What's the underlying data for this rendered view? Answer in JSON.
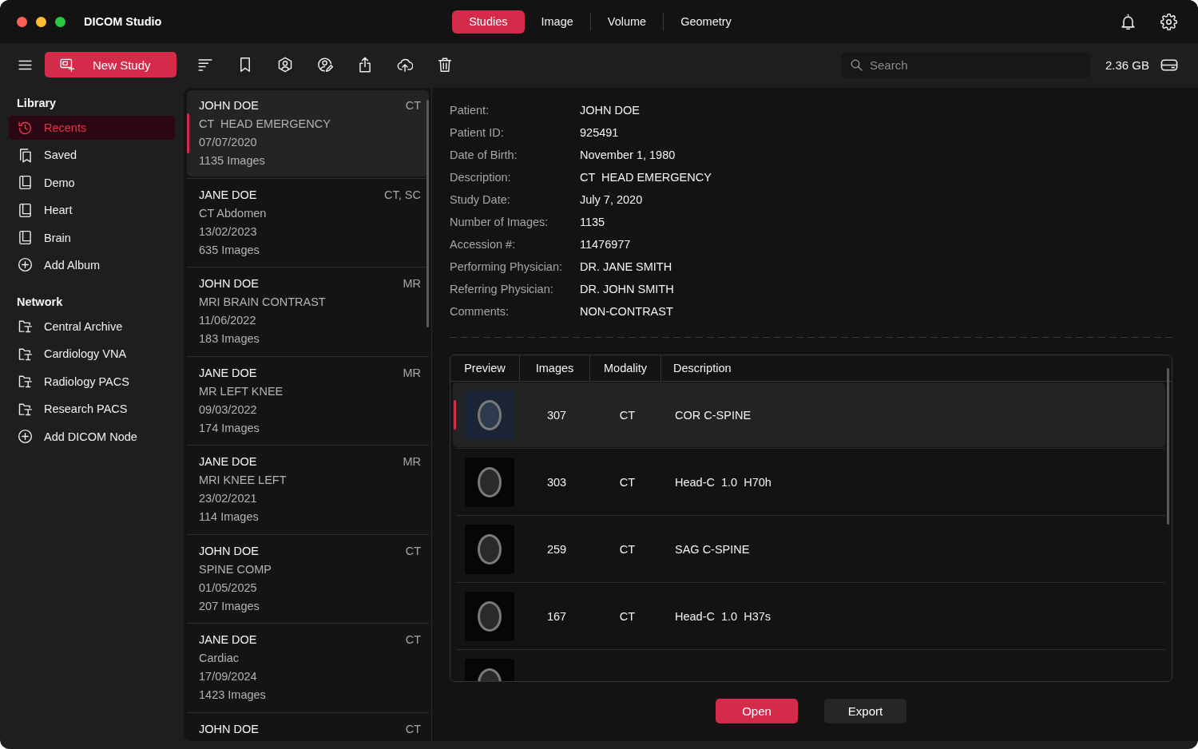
{
  "window": {
    "title": "DICOM Studio"
  },
  "tabs": [
    {
      "label": "Studies",
      "selected": true
    },
    {
      "label": "Image",
      "selected": false
    },
    {
      "label": "Volume",
      "selected": false
    },
    {
      "label": "Geometry",
      "selected": false
    }
  ],
  "toolbar": {
    "new_study": "New Study",
    "search": {
      "placeholder": "Search"
    },
    "storage": "2.36 GB"
  },
  "sidebar": {
    "sections": [
      {
        "heading": "Library",
        "items": [
          {
            "label": "Recents",
            "kind": "history",
            "selected": true
          },
          {
            "label": "Saved",
            "kind": "saved",
            "selected": false
          },
          {
            "label": "Demo",
            "kind": "album",
            "selected": false
          },
          {
            "label": "Heart",
            "kind": "album",
            "selected": false
          },
          {
            "label": "Brain",
            "kind": "album",
            "selected": false
          },
          {
            "label": "Add Album",
            "kind": "add",
            "selected": false
          }
        ]
      },
      {
        "heading": "Network",
        "items": [
          {
            "label": "Central Archive",
            "kind": "node",
            "selected": false
          },
          {
            "label": "Cardiology VNA",
            "kind": "node",
            "selected": false
          },
          {
            "label": "Radiology PACS",
            "kind": "node",
            "selected": false
          },
          {
            "label": "Research PACS",
            "kind": "node",
            "selected": false
          },
          {
            "label": "Add DICOM Node",
            "kind": "add",
            "selected": false
          }
        ]
      }
    ]
  },
  "studies": [
    {
      "patient": "JOHN DOE",
      "modality": "CT",
      "description": "CT  HEAD EMERGENCY",
      "date": "07/07/2020",
      "images": "1135 Images",
      "selected": true
    },
    {
      "patient": "JANE DOE",
      "modality": "CT, SC",
      "description": "CT Abdomen",
      "date": "13/02/2023",
      "images": "635 Images",
      "selected": false
    },
    {
      "patient": "JOHN DOE",
      "modality": "MR",
      "description": "MRI BRAIN CONTRAST",
      "date": "11/06/2022",
      "images": "183 Images",
      "selected": false
    },
    {
      "patient": "JANE DOE",
      "modality": "MR",
      "description": "MR LEFT KNEE",
      "date": "09/03/2022",
      "images": "174 Images",
      "selected": false
    },
    {
      "patient": "JANE DOE",
      "modality": "MR",
      "description": "MRI KNEE LEFT",
      "date": "23/02/2021",
      "images": "114 Images",
      "selected": false
    },
    {
      "patient": "JOHN DOE",
      "modality": "CT",
      "description": "SPINE COMP",
      "date": "01/05/2025",
      "images": "207 Images",
      "selected": false
    },
    {
      "patient": "JANE DOE",
      "modality": "CT",
      "description": "Cardiac",
      "date": "17/09/2024",
      "images": "1423 Images",
      "selected": false
    },
    {
      "patient": "JOHN DOE",
      "modality": "CT",
      "selected": false
    }
  ],
  "details": {
    "fields": [
      {
        "label": "Patient:",
        "value": "JOHN DOE"
      },
      {
        "label": "Patient ID:",
        "value": "925491"
      },
      {
        "label": "Date of Birth:",
        "value": "November 1, 1980"
      },
      {
        "label": "Description:",
        "value": "CT  HEAD EMERGENCY"
      },
      {
        "label": "Study Date:",
        "value": "July 7, 2020"
      },
      {
        "label": "Number of Images:",
        "value": "1135"
      },
      {
        "label": "Accession #:",
        "value": "11476977"
      },
      {
        "label": "Performing Physician:",
        "value": "DR. JANE SMITH"
      },
      {
        "label": "Referring Physician:",
        "value": "DR. JOHN SMITH"
      },
      {
        "label": "Comments:",
        "value": "NON-CONTRAST"
      }
    ]
  },
  "series_table": {
    "columns": [
      "Preview",
      "Images",
      "Modality",
      "Description"
    ],
    "rows": [
      {
        "images": "307",
        "modality": "CT",
        "description": "COR C-SPINE",
        "selected": true
      },
      {
        "images": "303",
        "modality": "CT",
        "description": "Head-C  1.0  H70h",
        "selected": false
      },
      {
        "images": "259",
        "modality": "CT",
        "description": "SAG C-SPINE",
        "selected": false
      },
      {
        "images": "167",
        "modality": "CT",
        "description": "Head-C  1.0  H37s",
        "selected": false
      },
      {
        "selected": false
      }
    ]
  },
  "buttons": [
    {
      "label": "Open",
      "kind": "primary"
    },
    {
      "label": "Export",
      "kind": "secondary"
    }
  ]
}
